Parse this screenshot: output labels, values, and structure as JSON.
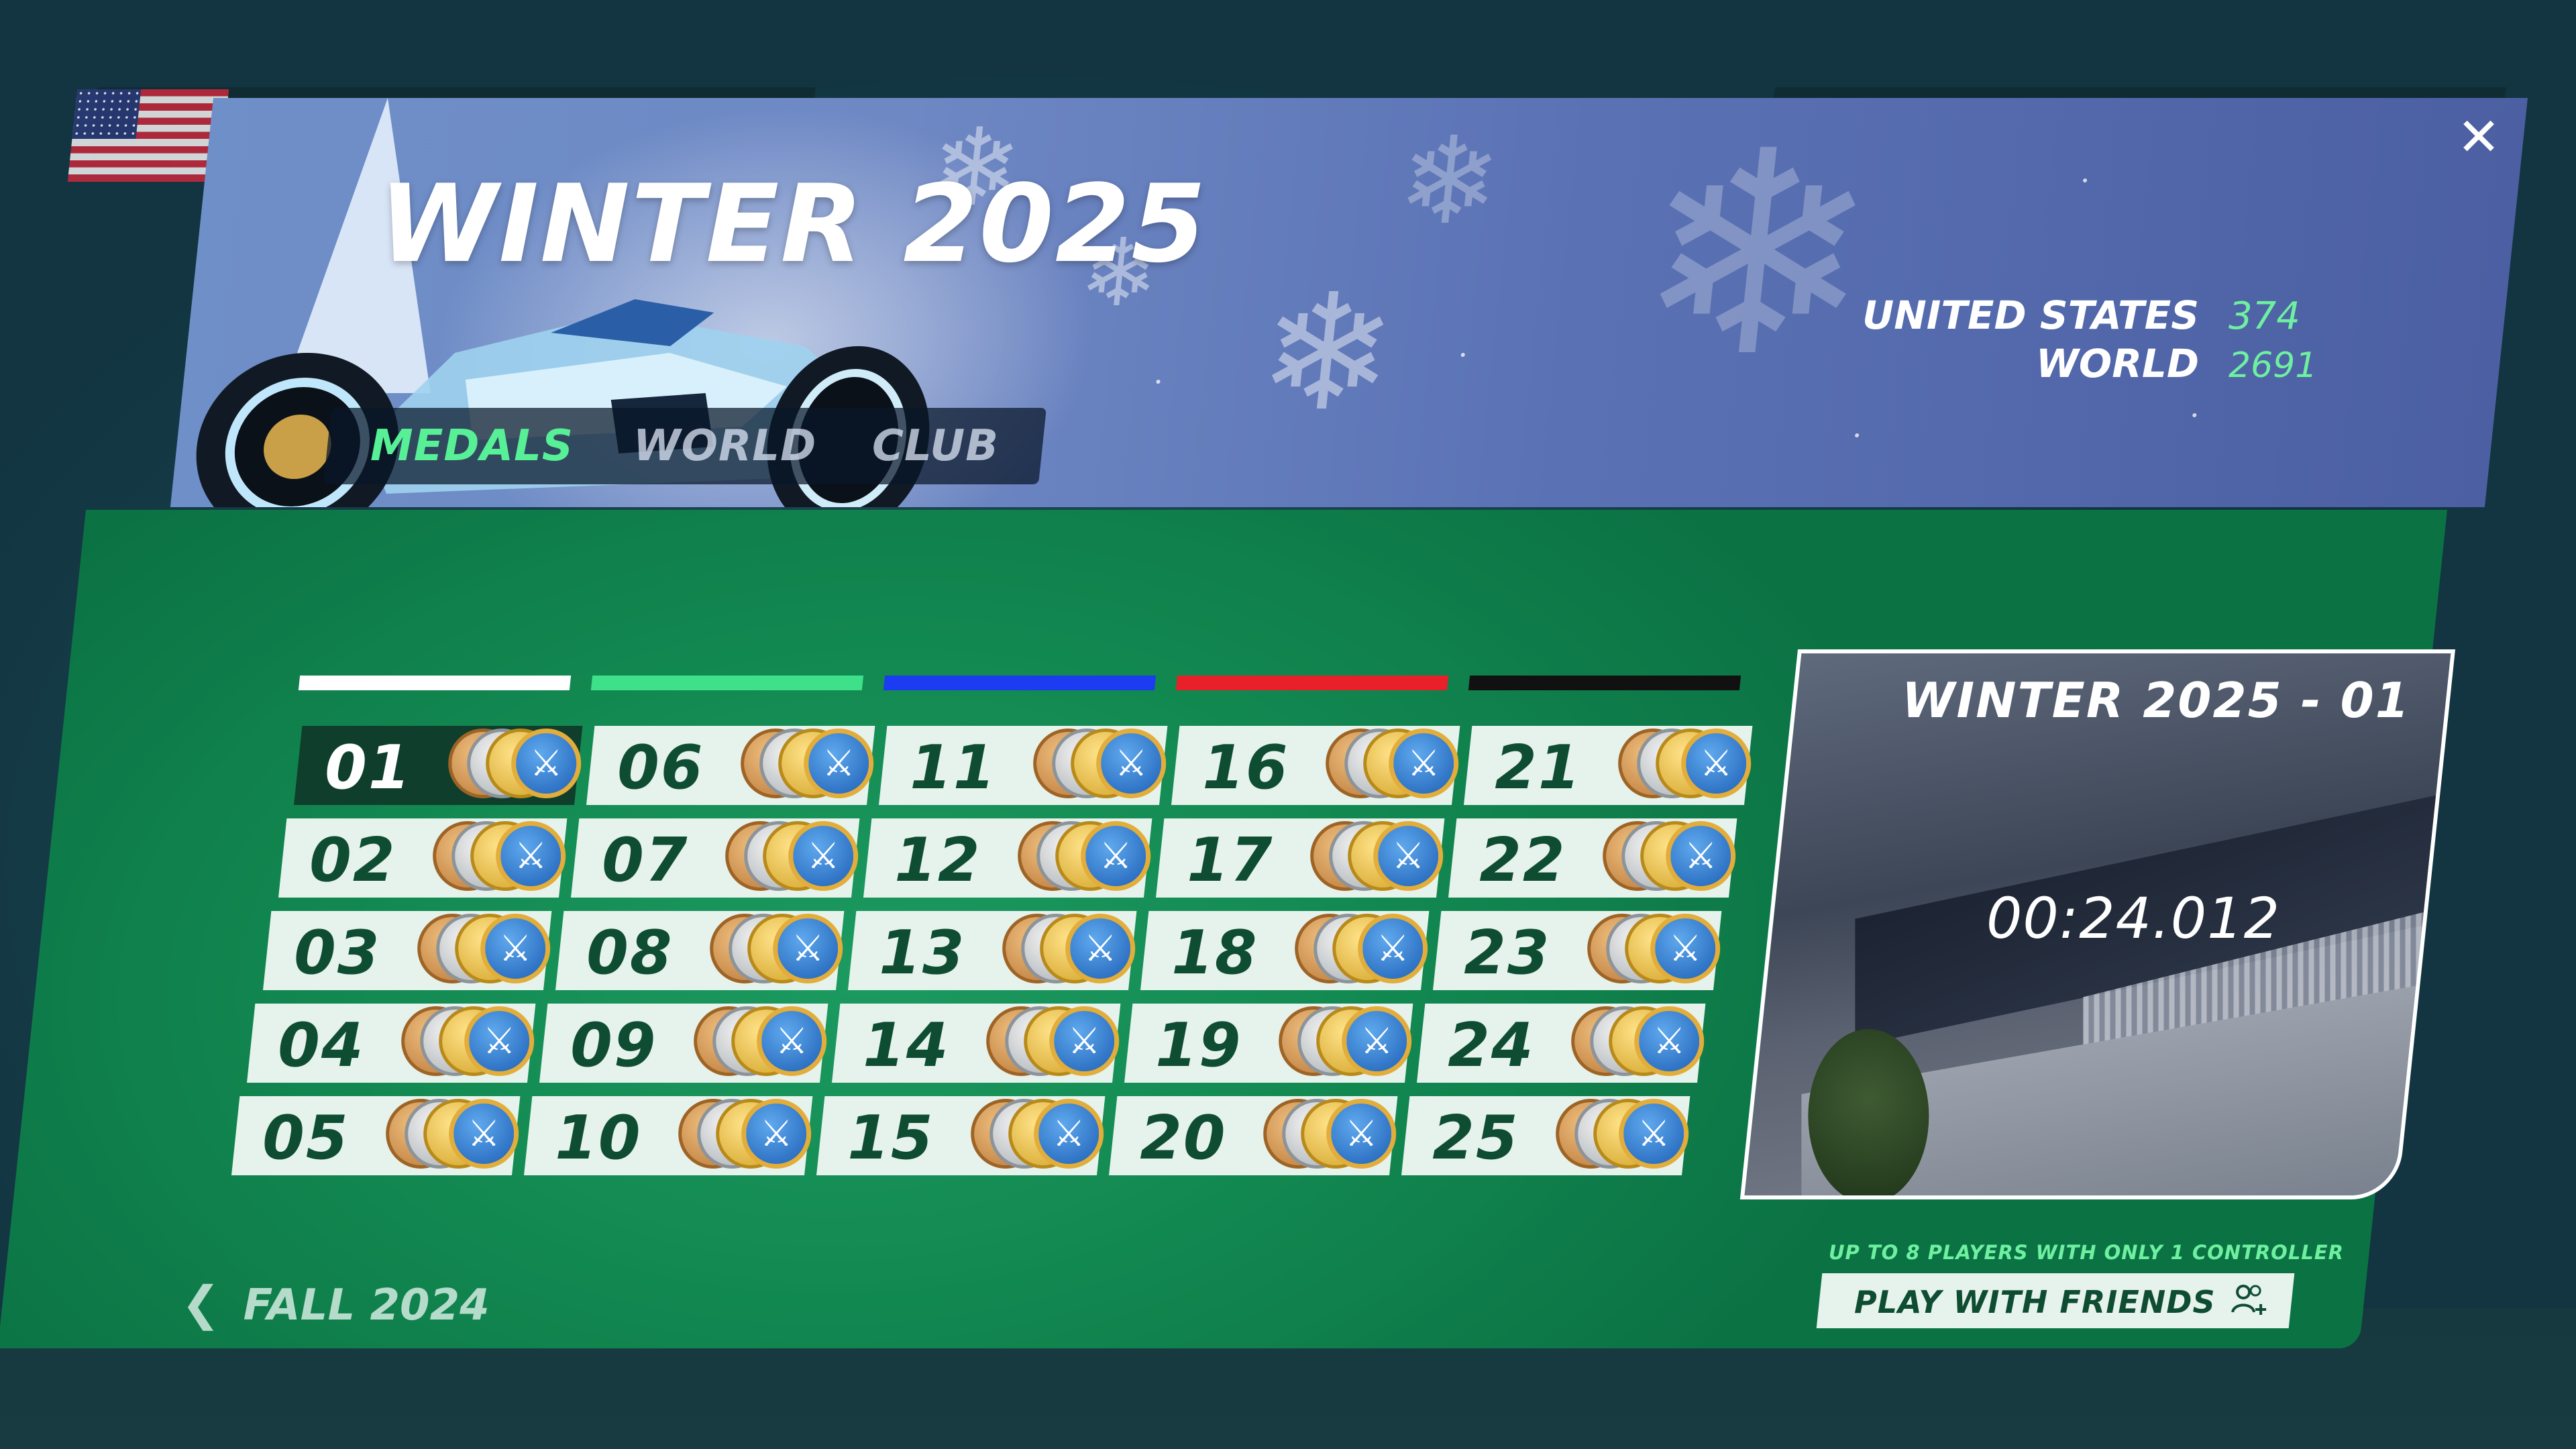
{
  "header": {
    "title": "WINTER 2025",
    "close_icon": "close-icon",
    "rankings": [
      {
        "label": "UNITED STATES",
        "value": "374"
      },
      {
        "label": "WORLD",
        "value": "2691"
      }
    ]
  },
  "tabs": [
    {
      "label": "MEDALS",
      "active": true
    },
    {
      "label": "WORLD",
      "active": false
    },
    {
      "label": "CLUB",
      "active": false
    }
  ],
  "difficulty_colors": [
    "#ffffff",
    "#3fe08a",
    "#1b3cf0",
    "#e8202a",
    "#111111"
  ],
  "tracks": [
    [
      "01",
      "02",
      "03",
      "04",
      "05"
    ],
    [
      "06",
      "07",
      "08",
      "09",
      "10"
    ],
    [
      "11",
      "12",
      "13",
      "14",
      "15"
    ],
    [
      "16",
      "17",
      "18",
      "19",
      "20"
    ],
    [
      "21",
      "22",
      "23",
      "24",
      "25"
    ]
  ],
  "selected_track": "01",
  "medal_icons": [
    "bronze-medal-icon",
    "silver-medal-icon",
    "gold-medal-icon",
    "author-medal-icon"
  ],
  "preview": {
    "title": "WINTER 2025 - 01",
    "time": "00:24.012"
  },
  "footer": {
    "back_label": "FALL 2024",
    "friends_note": "UP TO 8 PLAYERS WITH ONLY 1 CONTROLLER",
    "friends_button": "PLAY WITH FRIENDS"
  }
}
